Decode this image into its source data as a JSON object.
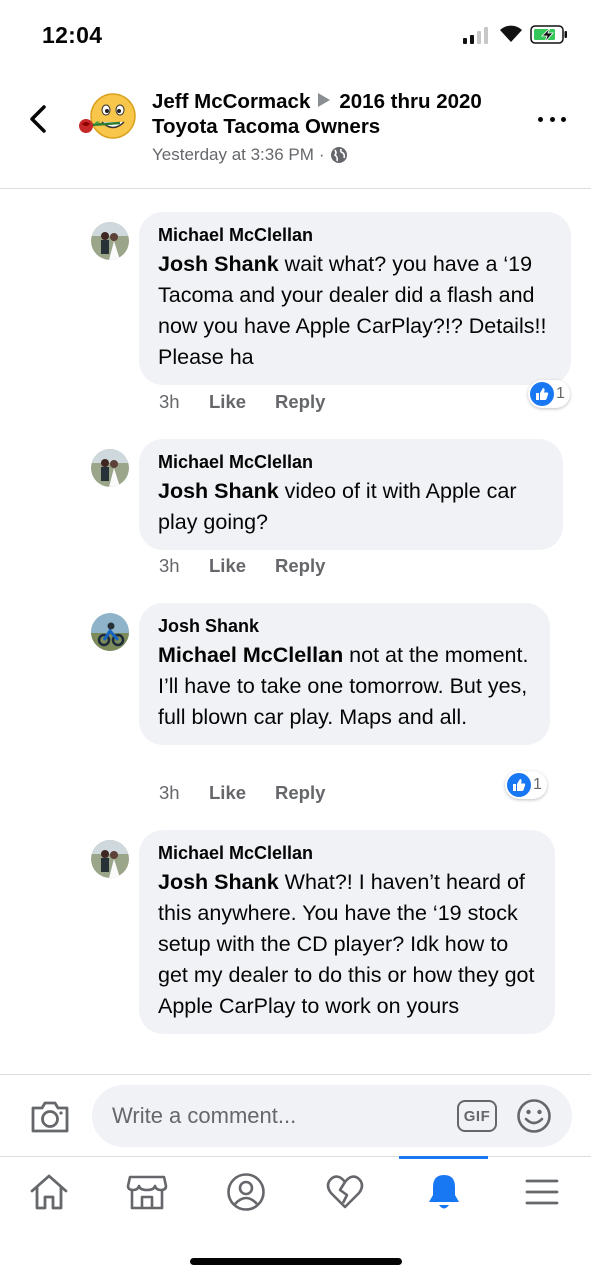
{
  "status_bar": {
    "time": "12:04"
  },
  "header": {
    "author": "Jeff McCormack",
    "group": "2016 thru 2020 Toyota Tacoma Owners",
    "timestamp": "Yesterday at 3:36 PM",
    "separator": "·"
  },
  "comments": [
    {
      "author": "Michael McClellan",
      "mention": "Josh Shank",
      "text": " wait what? you have a ‘19 Tacoma and your dealer did a flash and now you have Apple CarPlay?!? Details!! Please ha",
      "time": "3h",
      "like_label": "Like",
      "reply_label": "Reply",
      "reaction_count": "1"
    },
    {
      "author": "Michael McClellan",
      "mention": "Josh Shank",
      "text": " video of it with Apple car play going?",
      "time": "3h",
      "like_label": "Like",
      "reply_label": "Reply"
    },
    {
      "author": "Josh Shank",
      "mention": "Michael McClellan",
      "text": " not at the moment. I’ll have to take one tomorrow. But yes, full blown car play. Maps and all.",
      "time": "3h",
      "like_label": "Like",
      "reply_label": "Reply",
      "reaction_count": "1"
    },
    {
      "author": "Michael McClellan",
      "mention": "Josh Shank",
      "text": " What?! I haven’t heard of this anywhere. You have the ‘19 stock setup with the CD player? Idk how to get my dealer to do this or how they got Apple CarPlay to work on yours"
    }
  ],
  "composer": {
    "placeholder": "Write a comment...",
    "gif_label": "GIF"
  },
  "tabs": [
    {
      "icon": "home-icon"
    },
    {
      "icon": "marketplace-icon"
    },
    {
      "icon": "profile-icon"
    },
    {
      "icon": "dating-heart-icon"
    },
    {
      "icon": "notifications-bell-icon",
      "active": true
    },
    {
      "icon": "menu-icon"
    }
  ],
  "colors": {
    "accent": "#1877f2",
    "bubble": "#f0f2f5",
    "secondary_text": "#65676b"
  }
}
